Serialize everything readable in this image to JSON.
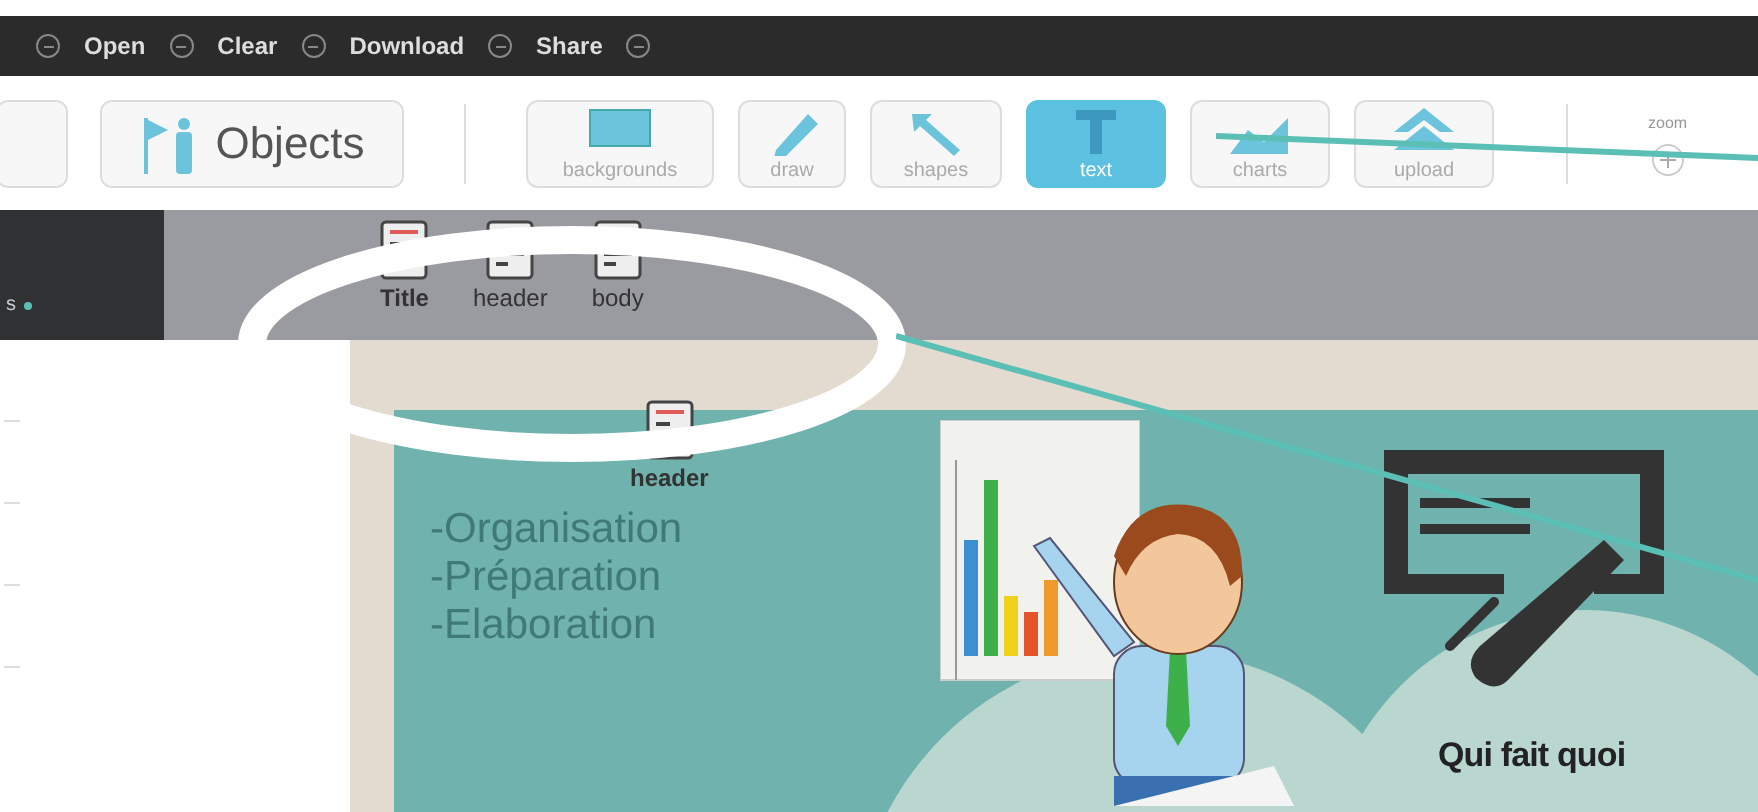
{
  "menu": [
    {
      "label": "Open"
    },
    {
      "label": "Clear"
    },
    {
      "label": "Download"
    },
    {
      "label": "Share"
    }
  ],
  "toolbar": {
    "objects_button": "Objects",
    "tools": [
      {
        "kind": "backgrounds",
        "label": "backgrounds",
        "selected": false
      },
      {
        "kind": "draw",
        "label": "draw",
        "selected": false
      },
      {
        "kind": "shapes",
        "label": "shapes",
        "selected": false
      },
      {
        "kind": "text",
        "label": "text",
        "selected": true
      },
      {
        "kind": "charts",
        "label": "charts",
        "selected": false
      },
      {
        "kind": "upload",
        "label": "upload",
        "selected": false
      }
    ],
    "zoom_label": "zoom"
  },
  "side_panel": {
    "label": "s"
  },
  "text_presets": [
    {
      "label": "Title"
    },
    {
      "label": "header"
    },
    {
      "label": "body"
    }
  ],
  "canvas": {
    "dragged_item": "header",
    "bullet_lines": [
      "-Organisation",
      "-Préparation",
      "-Elaboration"
    ],
    "caption": "Qui fait quoi"
  }
}
